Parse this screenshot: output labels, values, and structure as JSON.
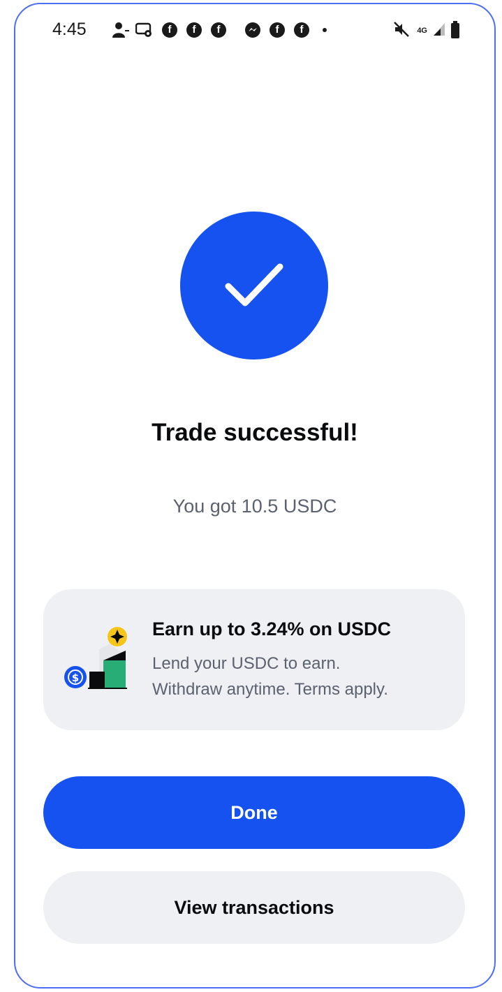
{
  "status_bar": {
    "time": "4:45",
    "notification_icons": [
      "person-add-icon",
      "voicemail-icon",
      "facebook-icon",
      "facebook-icon",
      "facebook-icon",
      "messenger-icon",
      "facebook-icon",
      "facebook-icon",
      "more-dot-icon"
    ],
    "system_icons": [
      "mute-icon",
      "lte-icon",
      "signal-icon",
      "battery-icon"
    ],
    "network_label": "4G"
  },
  "success": {
    "title": "Trade successful!",
    "subtitle": "You got 10.5 USDC"
  },
  "promo": {
    "title": "Earn up to 3.24% on USDC",
    "line1": "Lend your USDC to earn.",
    "line2": "Withdraw anytime. Terms apply."
  },
  "actions": {
    "done_label": "Done",
    "view_transactions_label": "View transactions"
  },
  "colors": {
    "primary": "#1652f0",
    "card_bg": "#eef0f3",
    "text_primary": "#0a0b0d",
    "text_secondary": "#5b616e",
    "accent_yellow": "#f5c518",
    "accent_green": "#27ad75"
  }
}
